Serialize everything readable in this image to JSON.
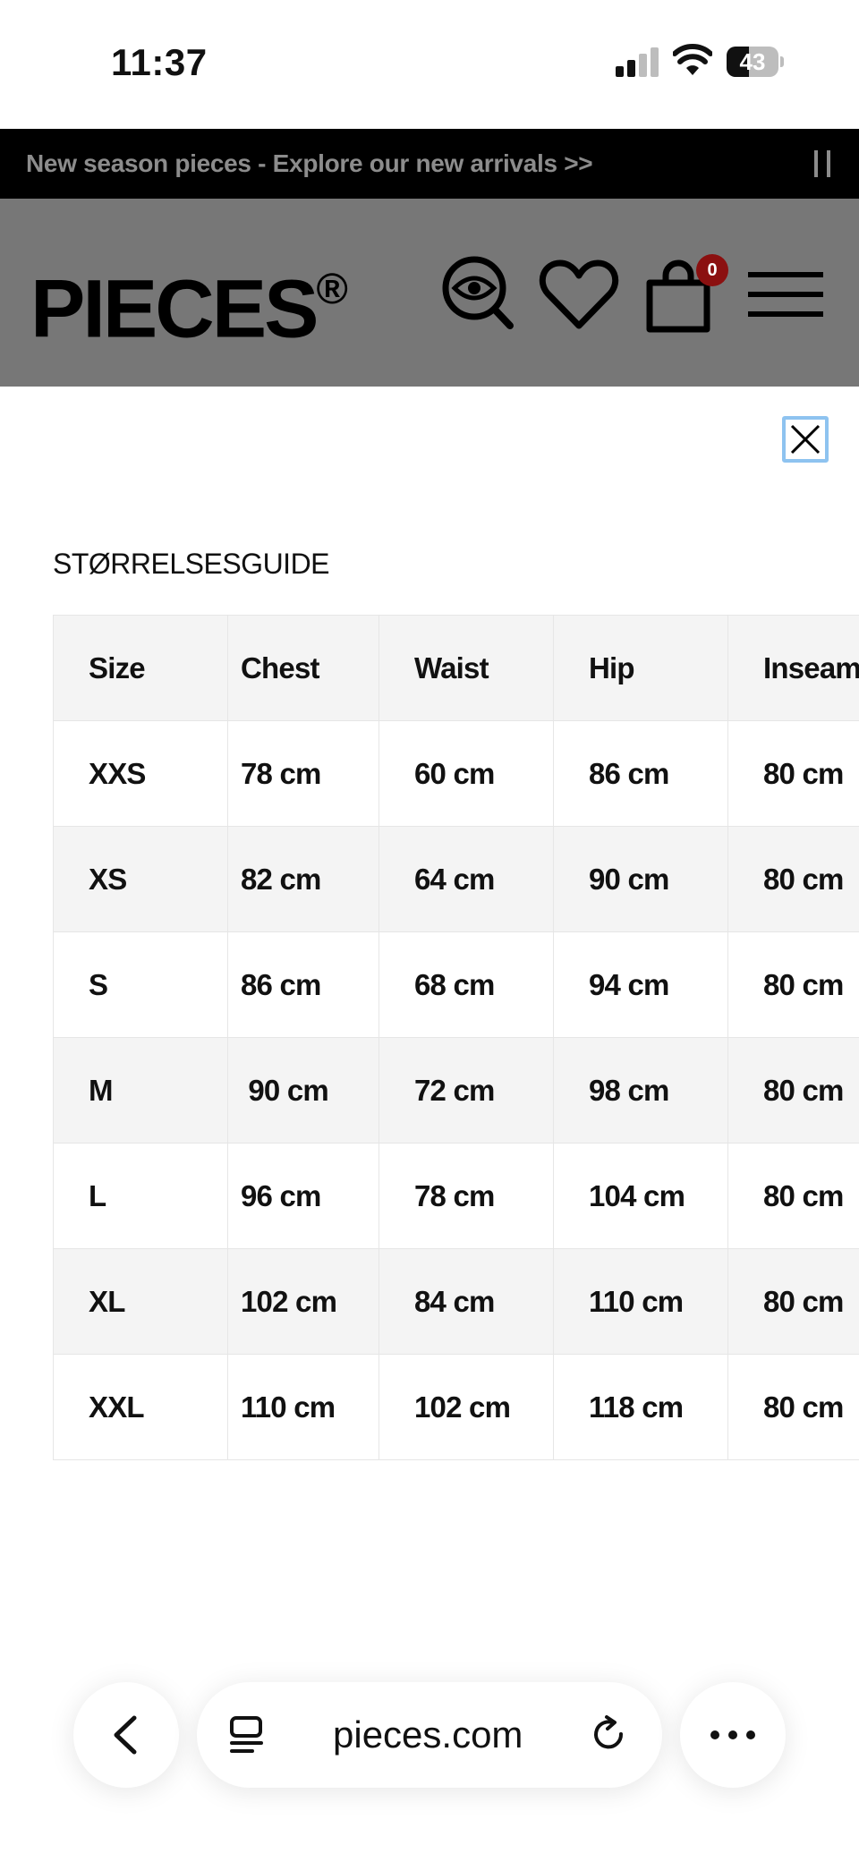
{
  "status_bar": {
    "time": "11:37",
    "battery": "43",
    "battery_level_percent": 43
  },
  "announcement": {
    "text": "New season pieces - Explore our new arrivals >>"
  },
  "header": {
    "logo": "PIECES",
    "logo_mark": "®",
    "bag_count": "0"
  },
  "icons": {
    "search": "search-eye-icon",
    "wishlist": "heart-icon",
    "bag": "shopping-bag-icon",
    "menu": "hamburger-menu-icon",
    "close": "close-icon",
    "back": "chevron-left-icon",
    "tabs": "tabs-icon",
    "reload": "reload-icon",
    "more": "more-dots-icon"
  },
  "colors": {
    "header_bg": "#777777",
    "announce_bg": "#000000",
    "badge": "#8b1010",
    "close_border": "#8ec3f0"
  },
  "size_guide": {
    "title": "STØRRELSESGUIDE",
    "columns": [
      "Size",
      "Chest",
      "Waist",
      "Hip",
      "Inseam"
    ],
    "rows": [
      [
        "XXS",
        "78 cm",
        "60 cm",
        "86 cm",
        "80 cm"
      ],
      [
        "XS",
        "82 cm",
        "64 cm",
        "90 cm",
        "80 cm"
      ],
      [
        "S",
        "86 cm",
        "68 cm",
        "94 cm",
        "80 cm"
      ],
      [
        "M",
        " 90 cm",
        "72 cm",
        "98 cm",
        "80 cm"
      ],
      [
        "L",
        "96 cm",
        "78 cm",
        "104 cm",
        "80 cm"
      ],
      [
        "XL",
        "102 cm",
        "84 cm",
        "110 cm",
        "80 cm"
      ],
      [
        "XXL",
        "110 cm",
        "102 cm",
        "118 cm",
        "80 cm"
      ]
    ]
  },
  "browser": {
    "url": "pieces.com"
  }
}
